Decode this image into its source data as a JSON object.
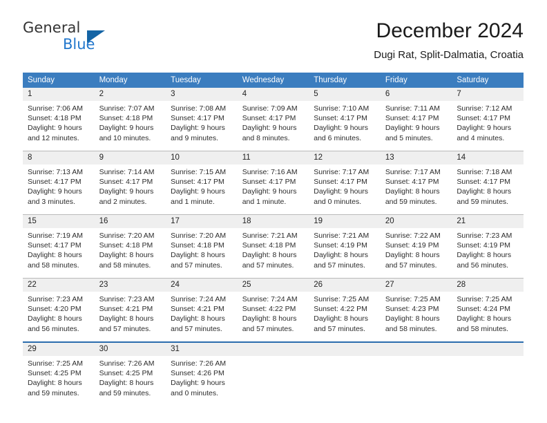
{
  "branding": {
    "name_part1": "General",
    "name_part2": "Blue"
  },
  "header": {
    "title": "December 2024",
    "subtitle": "Dugi Rat, Split-Dalmatia, Croatia"
  },
  "colors": {
    "header_blue": "#3b7dbf",
    "daynum_band": "#efefef",
    "divider_gray": "#b9b9b9",
    "divider_blue": "#2b6cad",
    "logo_blue": "#2277cc",
    "text": "#2b2b2b"
  },
  "weekday_headers": [
    "Sunday",
    "Monday",
    "Tuesday",
    "Wednesday",
    "Thursday",
    "Friday",
    "Saturday"
  ],
  "weeks": [
    {
      "days": [
        {
          "num": "1",
          "lines": [
            "Sunrise: 7:06 AM",
            "Sunset: 4:18 PM",
            "Daylight: 9 hours",
            "and 12 minutes."
          ]
        },
        {
          "num": "2",
          "lines": [
            "Sunrise: 7:07 AM",
            "Sunset: 4:18 PM",
            "Daylight: 9 hours",
            "and 10 minutes."
          ]
        },
        {
          "num": "3",
          "lines": [
            "Sunrise: 7:08 AM",
            "Sunset: 4:17 PM",
            "Daylight: 9 hours",
            "and 9 minutes."
          ]
        },
        {
          "num": "4",
          "lines": [
            "Sunrise: 7:09 AM",
            "Sunset: 4:17 PM",
            "Daylight: 9 hours",
            "and 8 minutes."
          ]
        },
        {
          "num": "5",
          "lines": [
            "Sunrise: 7:10 AM",
            "Sunset: 4:17 PM",
            "Daylight: 9 hours",
            "and 6 minutes."
          ]
        },
        {
          "num": "6",
          "lines": [
            "Sunrise: 7:11 AM",
            "Sunset: 4:17 PM",
            "Daylight: 9 hours",
            "and 5 minutes."
          ]
        },
        {
          "num": "7",
          "lines": [
            "Sunrise: 7:12 AM",
            "Sunset: 4:17 PM",
            "Daylight: 9 hours",
            "and 4 minutes."
          ]
        }
      ]
    },
    {
      "days": [
        {
          "num": "8",
          "lines": [
            "Sunrise: 7:13 AM",
            "Sunset: 4:17 PM",
            "Daylight: 9 hours",
            "and 3 minutes."
          ]
        },
        {
          "num": "9",
          "lines": [
            "Sunrise: 7:14 AM",
            "Sunset: 4:17 PM",
            "Daylight: 9 hours",
            "and 2 minutes."
          ]
        },
        {
          "num": "10",
          "lines": [
            "Sunrise: 7:15 AM",
            "Sunset: 4:17 PM",
            "Daylight: 9 hours",
            "and 1 minute."
          ]
        },
        {
          "num": "11",
          "lines": [
            "Sunrise: 7:16 AM",
            "Sunset: 4:17 PM",
            "Daylight: 9 hours",
            "and 1 minute."
          ]
        },
        {
          "num": "12",
          "lines": [
            "Sunrise: 7:17 AM",
            "Sunset: 4:17 PM",
            "Daylight: 9 hours",
            "and 0 minutes."
          ]
        },
        {
          "num": "13",
          "lines": [
            "Sunrise: 7:17 AM",
            "Sunset: 4:17 PM",
            "Daylight: 8 hours",
            "and 59 minutes."
          ]
        },
        {
          "num": "14",
          "lines": [
            "Sunrise: 7:18 AM",
            "Sunset: 4:17 PM",
            "Daylight: 8 hours",
            "and 59 minutes."
          ]
        }
      ]
    },
    {
      "days": [
        {
          "num": "15",
          "lines": [
            "Sunrise: 7:19 AM",
            "Sunset: 4:17 PM",
            "Daylight: 8 hours",
            "and 58 minutes."
          ]
        },
        {
          "num": "16",
          "lines": [
            "Sunrise: 7:20 AM",
            "Sunset: 4:18 PM",
            "Daylight: 8 hours",
            "and 58 minutes."
          ]
        },
        {
          "num": "17",
          "lines": [
            "Sunrise: 7:20 AM",
            "Sunset: 4:18 PM",
            "Daylight: 8 hours",
            "and 57 minutes."
          ]
        },
        {
          "num": "18",
          "lines": [
            "Sunrise: 7:21 AM",
            "Sunset: 4:18 PM",
            "Daylight: 8 hours",
            "and 57 minutes."
          ]
        },
        {
          "num": "19",
          "lines": [
            "Sunrise: 7:21 AM",
            "Sunset: 4:19 PM",
            "Daylight: 8 hours",
            "and 57 minutes."
          ]
        },
        {
          "num": "20",
          "lines": [
            "Sunrise: 7:22 AM",
            "Sunset: 4:19 PM",
            "Daylight: 8 hours",
            "and 57 minutes."
          ]
        },
        {
          "num": "21",
          "lines": [
            "Sunrise: 7:23 AM",
            "Sunset: 4:19 PM",
            "Daylight: 8 hours",
            "and 56 minutes."
          ]
        }
      ]
    },
    {
      "days": [
        {
          "num": "22",
          "lines": [
            "Sunrise: 7:23 AM",
            "Sunset: 4:20 PM",
            "Daylight: 8 hours",
            "and 56 minutes."
          ]
        },
        {
          "num": "23",
          "lines": [
            "Sunrise: 7:23 AM",
            "Sunset: 4:21 PM",
            "Daylight: 8 hours",
            "and 57 minutes."
          ]
        },
        {
          "num": "24",
          "lines": [
            "Sunrise: 7:24 AM",
            "Sunset: 4:21 PM",
            "Daylight: 8 hours",
            "and 57 minutes."
          ]
        },
        {
          "num": "25",
          "lines": [
            "Sunrise: 7:24 AM",
            "Sunset: 4:22 PM",
            "Daylight: 8 hours",
            "and 57 minutes."
          ]
        },
        {
          "num": "26",
          "lines": [
            "Sunrise: 7:25 AM",
            "Sunset: 4:22 PM",
            "Daylight: 8 hours",
            "and 57 minutes."
          ]
        },
        {
          "num": "27",
          "lines": [
            "Sunrise: 7:25 AM",
            "Sunset: 4:23 PM",
            "Daylight: 8 hours",
            "and 58 minutes."
          ]
        },
        {
          "num": "28",
          "lines": [
            "Sunrise: 7:25 AM",
            "Sunset: 4:24 PM",
            "Daylight: 8 hours",
            "and 58 minutes."
          ]
        }
      ]
    },
    {
      "days": [
        {
          "num": "29",
          "lines": [
            "Sunrise: 7:25 AM",
            "Sunset: 4:25 PM",
            "Daylight: 8 hours",
            "and 59 minutes."
          ]
        },
        {
          "num": "30",
          "lines": [
            "Sunrise: 7:26 AM",
            "Sunset: 4:25 PM",
            "Daylight: 8 hours",
            "and 59 minutes."
          ]
        },
        {
          "num": "31",
          "lines": [
            "Sunrise: 7:26 AM",
            "Sunset: 4:26 PM",
            "Daylight: 9 hours",
            "and 0 minutes."
          ]
        },
        {
          "num": "",
          "lines": []
        },
        {
          "num": "",
          "lines": []
        },
        {
          "num": "",
          "lines": []
        },
        {
          "num": "",
          "lines": []
        }
      ]
    }
  ]
}
